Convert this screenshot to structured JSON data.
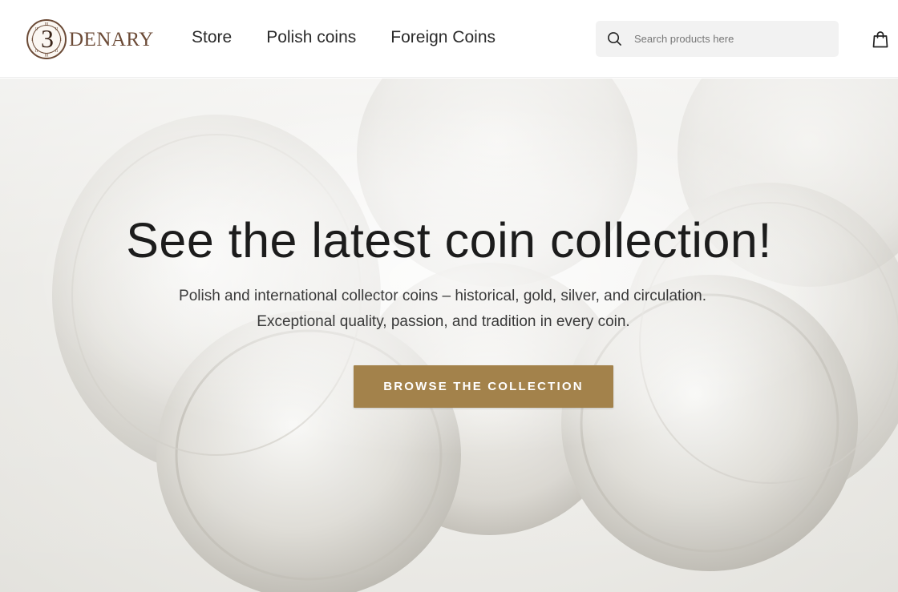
{
  "brand": {
    "name": "DENARY",
    "logo_numeral": "3",
    "accent_color": "#6b4a36"
  },
  "nav": {
    "items": [
      {
        "label": "Store"
      },
      {
        "label": "Polish coins"
      },
      {
        "label": "Foreign Coins"
      }
    ]
  },
  "search": {
    "placeholder": "Search products here",
    "value": "",
    "icon": "search-icon"
  },
  "cart": {
    "icon": "shopping-bag-icon"
  },
  "hero": {
    "title": "See the latest coin collection!",
    "subtitle_line1": "Polish and international collector coins – historical, gold, silver, and circulation.",
    "subtitle_line2": "Exceptional quality, passion, and tradition in every coin.",
    "cta_label": "BROWSE THE COLLECTION",
    "cta_color": "#a3824b",
    "background_image": "silver-coins-photo"
  }
}
